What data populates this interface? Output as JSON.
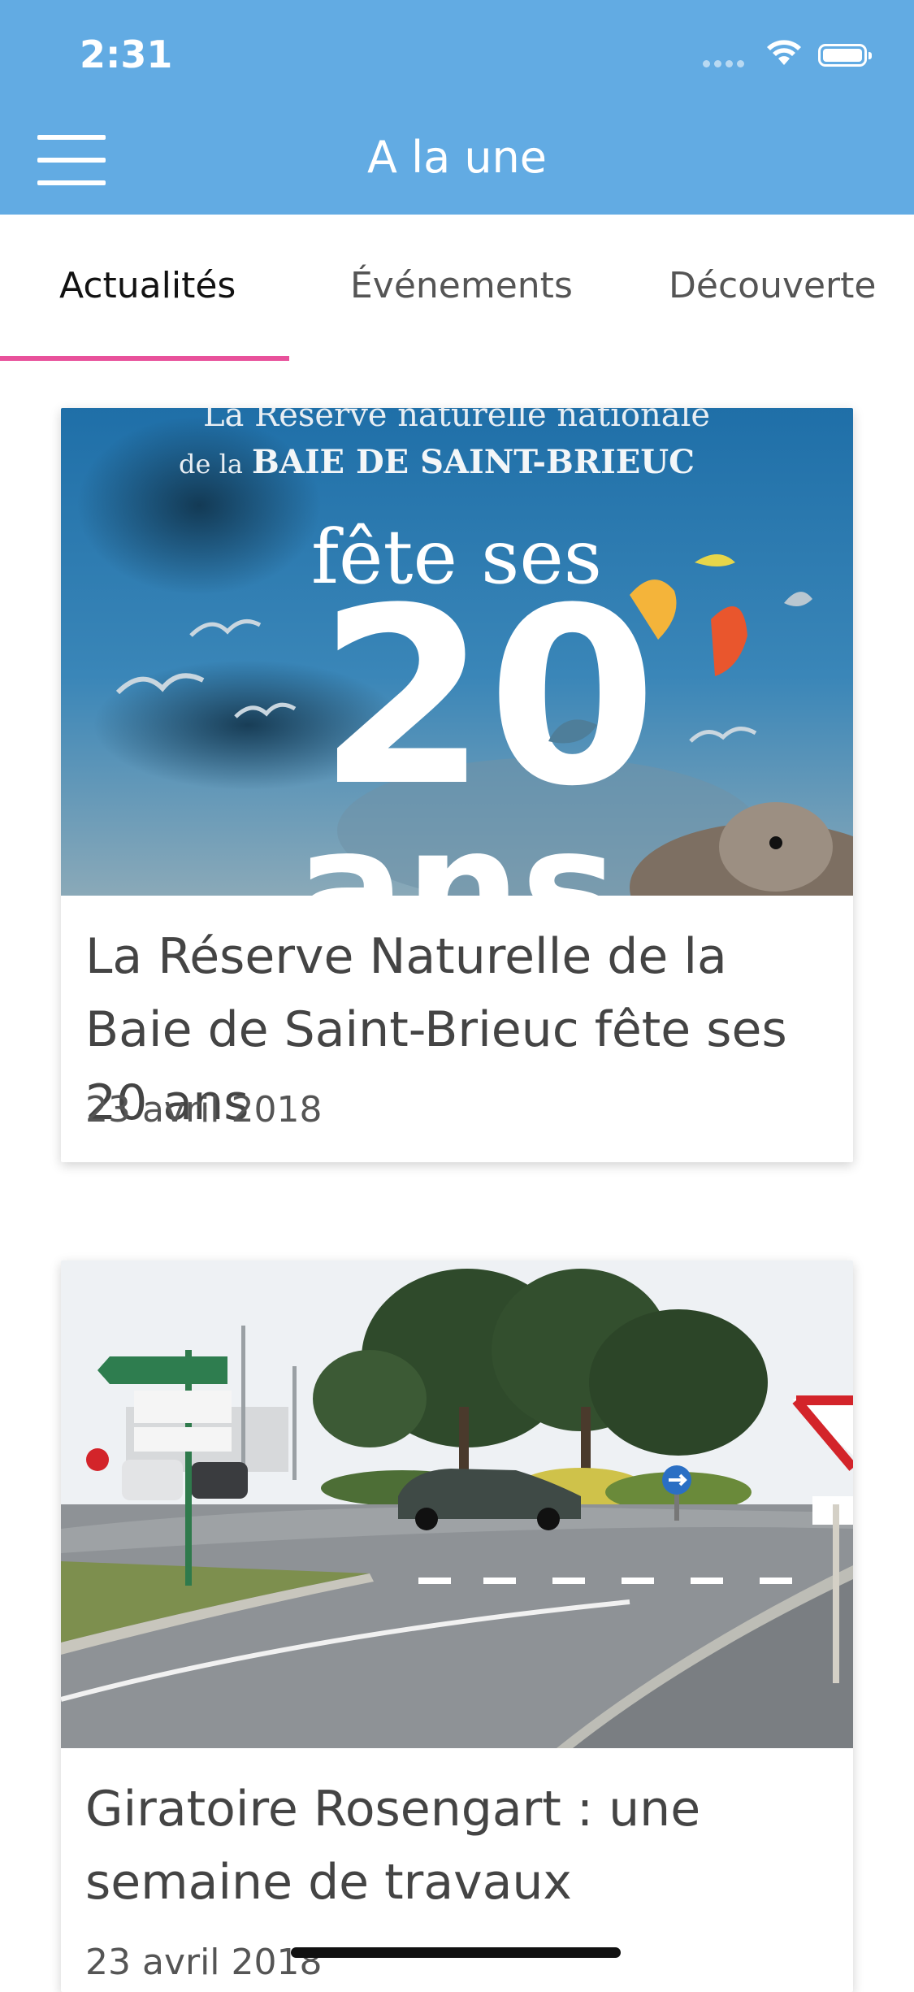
{
  "status_bar": {
    "time": "2:31",
    "icons": [
      "signal-dots-icon",
      "wifi-icon",
      "battery-icon"
    ]
  },
  "header": {
    "title": "A la une",
    "menu_icon": "hamburger-menu-icon",
    "background_color": "#62abe3"
  },
  "tabs": [
    {
      "label": "Actualités",
      "active": true
    },
    {
      "label": "Événements",
      "active": false
    },
    {
      "label": "Découverte",
      "active": false
    }
  ],
  "accent_color": "#e8519b",
  "articles": [
    {
      "poster_text": {
        "line1": "La Réserve naturelle nationale",
        "line2_prefix": "de la",
        "line2": "BAIE DE SAINT-BRIEUC",
        "line3": "fête ses",
        "number": "20",
        "line4": "ans"
      },
      "title": "La Réserve Naturelle de la Baie de Saint-Brieuc fête ses 20 ans",
      "date": "23 avril 2018"
    },
    {
      "title": "Giratoire Rosengart : une semaine de travaux",
      "date": "23 avril 2018"
    }
  ]
}
